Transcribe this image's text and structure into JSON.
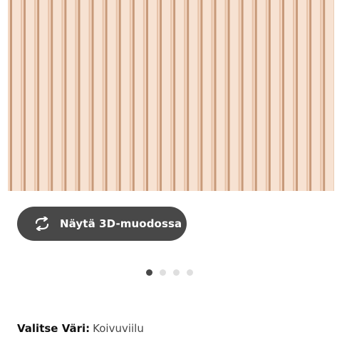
{
  "product_image": {
    "alt": "",
    "colors": {
      "panel": "#f4d8c4",
      "slat_light": "#f7e2d2",
      "slat_shadow": "#d8a785",
      "gap_dark": "#c79a7a"
    }
  },
  "view_3d_button": {
    "label": "Näytä 3D-muodossa",
    "icon": "rotate-arrows-icon",
    "background": "#484848"
  },
  "carousel": {
    "dot_count": 4,
    "active_index": 0
  },
  "color_selector": {
    "label": "Valitse Väri:",
    "value": "Koivuviilu"
  }
}
